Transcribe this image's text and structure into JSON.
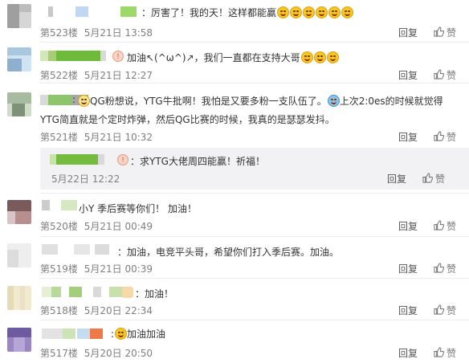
{
  "comments": [
    {
      "text": "：厉害了！我的天！这样都能赢",
      "emoji_count": 6,
      "floor": "第523楼",
      "date": "5月21日 13:58",
      "reply": "回复",
      "like": "赞"
    },
    {
      "text": "加油↖(^ω^)↗，我们一直都在支持大哥",
      "emoji_count": 3,
      "floor": "第522楼",
      "date": "5月21日 12:27",
      "reply": "回复",
      "like": "赞"
    },
    {
      "text_line1": "QG粉想说，YTG牛批啊！我怕是又要多粉一支队伍了。",
      "text_line1b": "上次2:0es的时候就觉得",
      "text_line2": "YTG简直就是个定时炸弹，然后QG比赛的时候，我真的是瑟瑟发抖。",
      "floor": "第521楼",
      "date": "5月21日 10:32",
      "reply": "回复",
      "like": "赞"
    },
    {
      "text": "：求YTG大佬周四能赢！祈福！",
      "date": "5月22日 12:22",
      "reply": "回复",
      "like": "赞"
    },
    {
      "text": "小Y 季后赛等你们！ 加油！",
      "floor": "第520楼",
      "date": "5月21日 00:49",
      "reply": "回复",
      "like": "赞"
    },
    {
      "text": "：加油，电竞平头哥，希望你们打入季后赛。加油。",
      "floor": "第519楼",
      "date": "5月21日 00:39",
      "reply": "回复",
      "like": "赞"
    },
    {
      "text": "：加油！",
      "floor": "第518楼",
      "date": "5月20日 22:34",
      "reply": "回复",
      "like": "赞"
    },
    {
      "text": "加油加油",
      "floor": "第517楼",
      "date": "5月20日 20:50",
      "reply": "回复",
      "like": "赞"
    }
  ],
  "colors": {
    "meta": "#808080",
    "divider": "#ececec",
    "subbox": "#f2f2f5"
  },
  "icons": {
    "like": "thumbs-up-icon",
    "emoji": "smiley-emoji-icon"
  }
}
